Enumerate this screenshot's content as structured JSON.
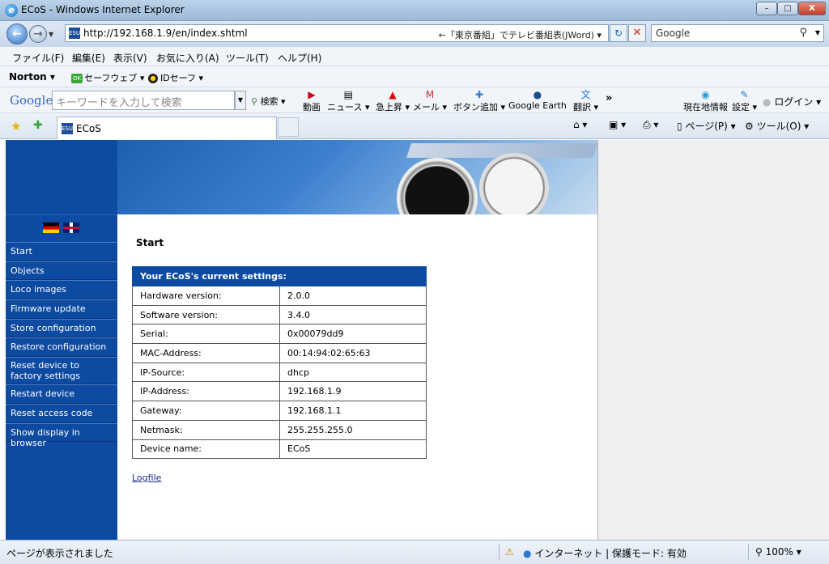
{
  "window": {
    "title": "ECoS - Windows Internet Explorer",
    "minimize": "–",
    "maximize": "□",
    "close": "X"
  },
  "address_bar": {
    "url": "http://192.168.1.9/en/index.shtml",
    "hint": "←「東京番組」でテレビ番組表(JWord) ▾",
    "search_placeholder": "Google"
  },
  "menu": [
    "ファイル(F)",
    "編集(E)",
    "表示(V)",
    "お気に入り(A)",
    "ツール(T)",
    "ヘルプ(H)"
  ],
  "norton_bar": {
    "norton": "Norton ▾",
    "safeweb": "セーフウェブ ▾",
    "idsafe": "IDセーフ ▾",
    "safeweb_badge": "OK"
  },
  "google_toolbar": {
    "logo": "Google",
    "search_placeholder": "キーワードを入力して検索",
    "search_btn": "検索 ▾",
    "tools": [
      "動画",
      "ニュース ▾",
      "急上昇 ▾",
      "メール ▾",
      "ボタン追加 ▾",
      "Google Earth",
      "翻訳 ▾"
    ],
    "more": "»",
    "right_tools": [
      "現在地情報",
      "設定 ▾"
    ],
    "login": "ログイン ▾"
  },
  "tabs": {
    "active": "ECoS"
  },
  "command_bar": {
    "page": "ページ(P) ▾",
    "tools": "ツール(O) ▾"
  },
  "sidebar": {
    "items": [
      "Start",
      "Objects",
      "Loco images",
      "Firmware update",
      "Store configuration",
      "Restore configuration",
      "Reset device to factory settings",
      "Restart device",
      "Reset access code",
      "Show display in browser"
    ]
  },
  "main": {
    "heading": "Start",
    "table_header": "Your ECoS's current settings:",
    "rows": [
      [
        "Hardware version:",
        "2.0.0"
      ],
      [
        "Software version:",
        "3.4.0"
      ],
      [
        "Serial:",
        "0x00079dd9"
      ],
      [
        "MAC-Address:",
        "00:14:94:02:65:63"
      ],
      [
        "IP-Source:",
        "dhcp"
      ],
      [
        "IP-Address:",
        "192.168.1.9"
      ],
      [
        "Gateway:",
        "192.168.1.1"
      ],
      [
        "Netmask:",
        "255.255.255.0"
      ],
      [
        "Device name:",
        "ECoS"
      ]
    ],
    "logfile": "Logfile"
  },
  "status_bar": {
    "message": "ページが表示されました",
    "zone": "インターネット | 保護モード: 有効",
    "zoom": "100%  ▾"
  },
  "colors": {
    "accent_blue": "#0d4aa2",
    "link": "#1a2a8a"
  }
}
